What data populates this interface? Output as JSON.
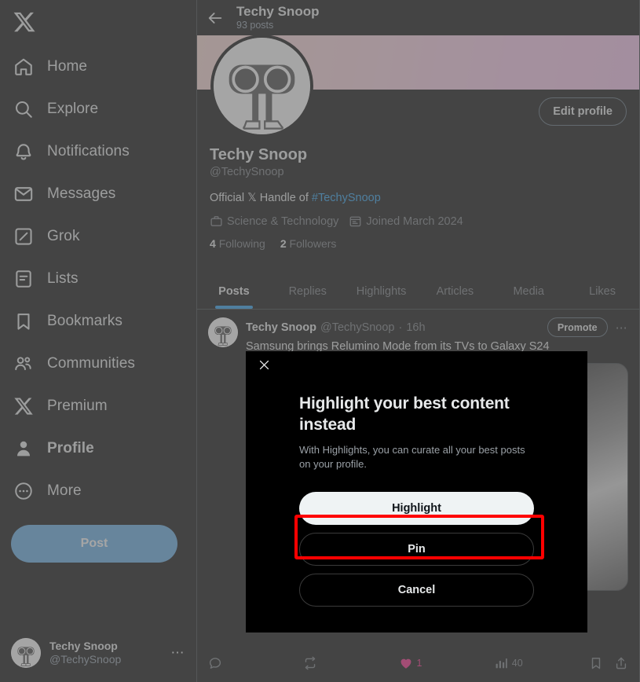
{
  "sidebar": {
    "logo_icon": "x-logo-icon",
    "items": [
      {
        "label": "Home",
        "icon": "home-icon"
      },
      {
        "label": "Explore",
        "icon": "search-icon"
      },
      {
        "label": "Notifications",
        "icon": "bell-icon"
      },
      {
        "label": "Messages",
        "icon": "envelope-icon"
      },
      {
        "label": "Grok",
        "icon": "grok-icon"
      },
      {
        "label": "Lists",
        "icon": "lists-icon"
      },
      {
        "label": "Bookmarks",
        "icon": "bookmark-icon"
      },
      {
        "label": "Communities",
        "icon": "communities-icon"
      },
      {
        "label": "Premium",
        "icon": "x-logo-icon"
      },
      {
        "label": "Profile",
        "icon": "person-icon"
      },
      {
        "label": "More",
        "icon": "more-circle-icon"
      }
    ],
    "post_button": "Post",
    "account": {
      "name": "Techy Snoop",
      "handle": "@TechySnoop",
      "more_icon": "ellipsis-icon"
    }
  },
  "topbar": {
    "back_icon": "back-arrow-icon",
    "title": "Techy Snoop",
    "subtitle": "93 posts"
  },
  "profile": {
    "edit_button": "Edit profile",
    "name": "Techy Snoop",
    "handle": "@TechySnoop",
    "bio_prefix": "Official ",
    "bio_x": "𝕏",
    "bio_mid": " Handle of ",
    "bio_tag": "#TechySnoop",
    "category": "Science & Technology",
    "category_icon": "briefcase-icon",
    "joined": "Joined March 2024",
    "joined_icon": "calendar-icon",
    "following_count": "4",
    "following_label": "Following",
    "followers_count": "2",
    "followers_label": "Followers"
  },
  "tabs": [
    {
      "label": "Posts",
      "active": true
    },
    {
      "label": "Replies",
      "active": false
    },
    {
      "label": "Highlights",
      "active": false
    },
    {
      "label": "Articles",
      "active": false
    },
    {
      "label": "Media",
      "active": false
    },
    {
      "label": "Likes",
      "active": false
    }
  ],
  "post": {
    "author_name": "Techy Snoop",
    "author_handle": "@TechySnoop",
    "dot": "·",
    "time": "16h",
    "promote_label": "Promote",
    "more_icon": "ellipsis-icon",
    "text": "Samsung brings Relumino Mode from its TVs to Galaxy S24",
    "actions": {
      "reply_icon": "reply-icon",
      "reply_count": "",
      "repost_icon": "repost-icon",
      "repost_count": "",
      "like_icon": "heart-filled-icon",
      "like_count": "1",
      "views_icon": "analytics-icon",
      "views_count": "40",
      "bookmark_icon": "bookmark-icon",
      "share_icon": "share-icon"
    }
  },
  "modal": {
    "close_icon": "close-icon",
    "title": "Highlight your best content instead",
    "subtitle": "With Highlights, you can curate all your best posts on your profile.",
    "buttons": [
      {
        "label": "Highlight",
        "style": "primary"
      },
      {
        "label": "Pin",
        "style": "secondary"
      },
      {
        "label": "Cancel",
        "style": "secondary"
      }
    ]
  },
  "annotation": {
    "highlight_color": "#ff0000",
    "target": "Pin"
  },
  "colors": {
    "accent": "#1d9bf0",
    "post_button": "#5eaae8",
    "like": "#f91880",
    "muted_text": "#71767b"
  }
}
